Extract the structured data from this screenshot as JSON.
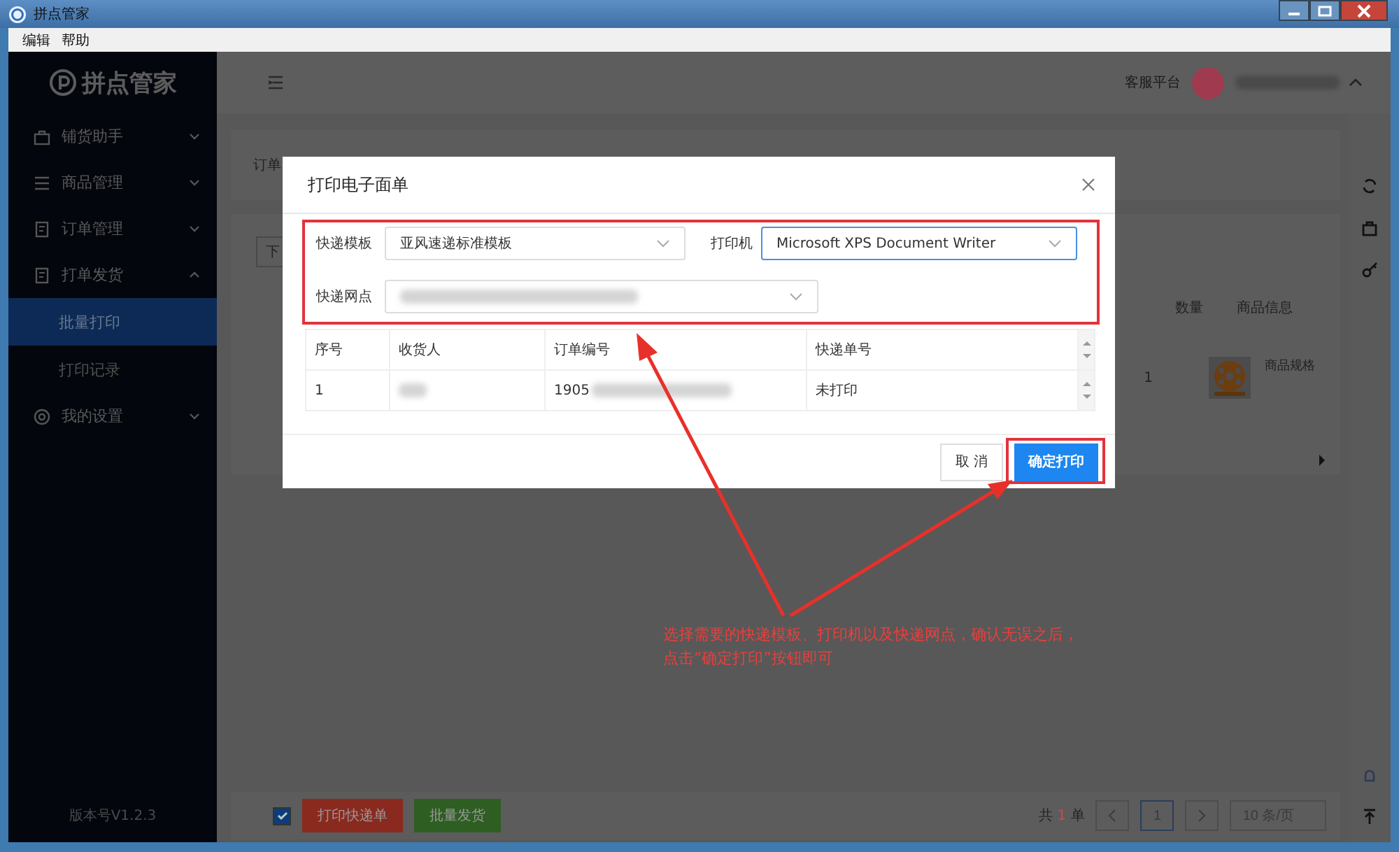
{
  "window": {
    "title": "拼点管家"
  },
  "menu": [
    "编辑",
    "帮助"
  ],
  "sidebar": {
    "logo": "拼点管家",
    "items": [
      {
        "label": "铺货助手",
        "expanded": false
      },
      {
        "label": "商品管理",
        "expanded": false
      },
      {
        "label": "订单管理",
        "expanded": false
      },
      {
        "label": "打单发货",
        "expanded": true,
        "children": [
          {
            "label": "批量打印",
            "selected": true
          },
          {
            "label": "打印记录",
            "selected": false
          }
        ]
      },
      {
        "label": "我的设置",
        "expanded": false
      }
    ],
    "version": "版本号V1.2.3"
  },
  "header": {
    "service": "客服平台"
  },
  "background": {
    "filter_label": "订单",
    "button": "下",
    "columns": [
      "数量",
      "商品信息"
    ],
    "row": {
      "quantity": "1",
      "spec": "商品规格"
    }
  },
  "bottom_bar": {
    "select_all": {
      "checked": true
    },
    "buttons": [
      {
        "label": "打印快递单",
        "color": "#8a2a1e"
      },
      {
        "label": "批量发货",
        "color": "#2e5e22"
      }
    ],
    "pagination": {
      "prefix": "共",
      "total": "1",
      "suffix": "单",
      "page": "1",
      "page_size": "10 条/页"
    }
  },
  "dialog": {
    "title": "打印电子面单",
    "fields": [
      {
        "label": "快递模板",
        "value": "亚风速递标准模板",
        "focused": false
      },
      {
        "label": "打印机",
        "value": "Microsoft XPS Document Writer",
        "focused": true
      },
      {
        "label": "快递网点",
        "focused": false
      }
    ],
    "columns": [
      "序号",
      "收货人",
      "订单编号",
      "快递单号"
    ],
    "rows": [
      {
        "index": "1",
        "order_no": "1905",
        "waybill": "未打印"
      }
    ],
    "cancel": "取 消",
    "confirm": "确定打印"
  },
  "annotation": {
    "note": [
      "选择需要的快递模板、打印机以及快递网点，确认无误之后，",
      "点击“确定打印”按钮即可"
    ]
  }
}
